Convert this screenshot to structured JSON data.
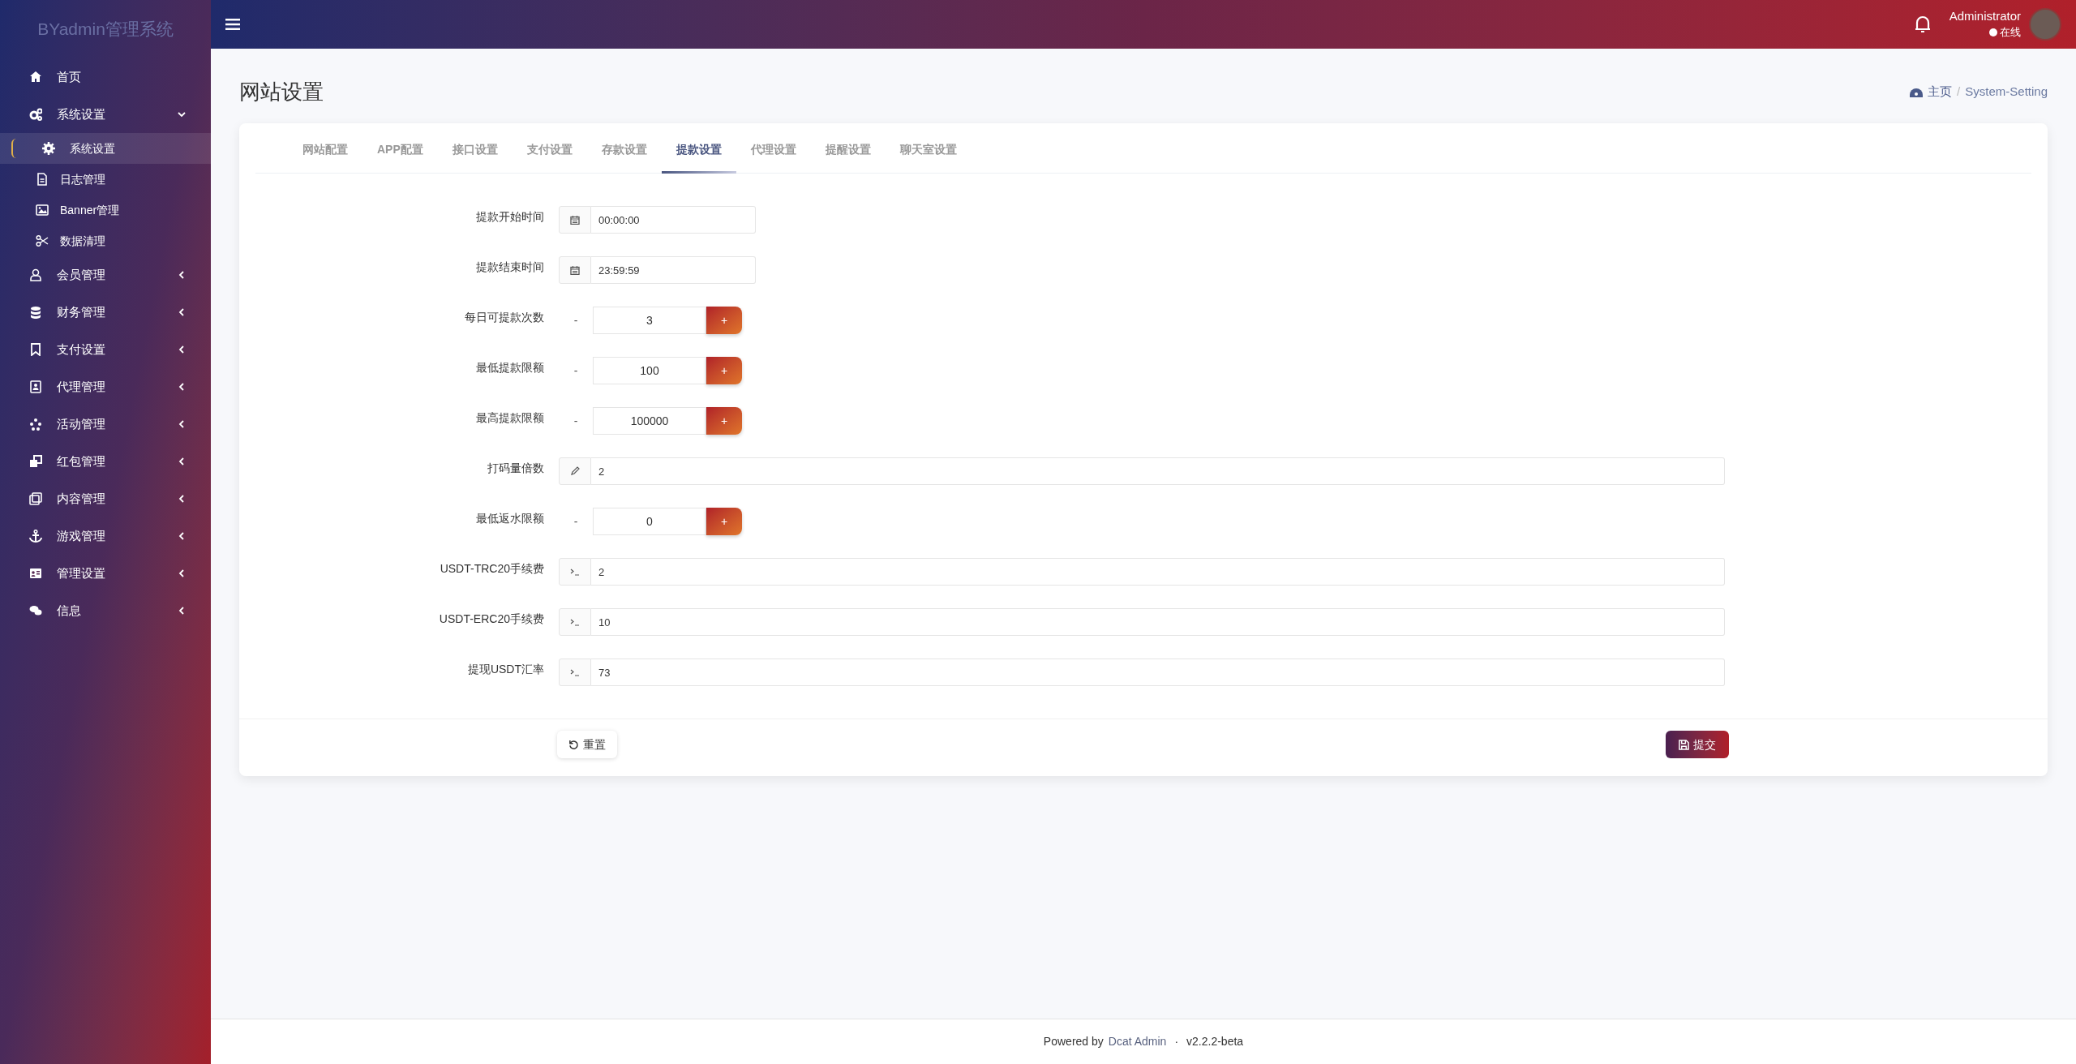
{
  "brand": "BYadmin管理系统",
  "sidebar": {
    "items": [
      {
        "label": "首页",
        "kind": "link"
      },
      {
        "label": "系统设置",
        "kind": "group",
        "expanded": true,
        "children": [
          {
            "label": "系统设置",
            "selected": true
          },
          {
            "label": "日志管理",
            "selected": false
          },
          {
            "label": "Banner管理",
            "selected": false
          },
          {
            "label": "数据清理",
            "selected": false
          }
        ]
      },
      {
        "label": "会员管理",
        "kind": "group",
        "expanded": false
      },
      {
        "label": "财务管理",
        "kind": "group",
        "expanded": false
      },
      {
        "label": "支付设置",
        "kind": "group",
        "expanded": false
      },
      {
        "label": "代理管理",
        "kind": "group",
        "expanded": false
      },
      {
        "label": "活动管理",
        "kind": "group",
        "expanded": false
      },
      {
        "label": "红包管理",
        "kind": "group",
        "expanded": false
      },
      {
        "label": "内容管理",
        "kind": "group",
        "expanded": false
      },
      {
        "label": "游戏管理",
        "kind": "group",
        "expanded": false
      },
      {
        "label": "管理设置",
        "kind": "group",
        "expanded": false
      },
      {
        "label": "信息",
        "kind": "group",
        "expanded": false
      }
    ]
  },
  "header": {
    "user_name": "Administrator",
    "user_status": "在线"
  },
  "page": {
    "title": "网站设置",
    "breadcrumb": [
      "主页",
      "System-Setting"
    ],
    "breadcrumb_separator": "/"
  },
  "tabs": [
    {
      "label": "网站配置",
      "selected": false
    },
    {
      "label": "APP配置",
      "selected": false
    },
    {
      "label": "接口设置",
      "selected": false
    },
    {
      "label": "支付设置",
      "selected": false
    },
    {
      "label": "存款设置",
      "selected": false
    },
    {
      "label": "提款设置",
      "selected": true
    },
    {
      "label": "代理设置",
      "selected": false
    },
    {
      "label": "提醒设置",
      "selected": false
    },
    {
      "label": "聊天室设置",
      "selected": false
    }
  ],
  "form": {
    "fields": [
      {
        "label": "提款开始时间",
        "kind": "time",
        "value": "00:00:00"
      },
      {
        "label": "提款结束时间",
        "kind": "time",
        "value": "23:59:59"
      },
      {
        "label": "每日可提款次数",
        "kind": "number",
        "value": "3",
        "minus": "-",
        "plus": "+"
      },
      {
        "label": "最低提款限额",
        "kind": "number",
        "value": "100",
        "minus": "-",
        "plus": "+"
      },
      {
        "label": "最高提款限额",
        "kind": "number",
        "value": "100000",
        "minus": "-",
        "plus": "+"
      },
      {
        "label": "打码量倍数",
        "kind": "edit",
        "value": "2"
      },
      {
        "label": "最低返水限额",
        "kind": "number",
        "value": "0",
        "minus": "-",
        "plus": "+"
      },
      {
        "label": "USDT-TRC20手续费",
        "kind": "code",
        "value": "2"
      },
      {
        "label": "USDT-ERC20手续费",
        "kind": "code",
        "value": "10"
      },
      {
        "label": "提现USDT汇率",
        "kind": "code",
        "value": "73"
      }
    ],
    "reset_button": "重置",
    "submit_button": "提交"
  },
  "footer": {
    "powered_by": "Powered by",
    "link": "Dcat Admin",
    "separator": "·",
    "version": "v2.2.2-beta"
  }
}
